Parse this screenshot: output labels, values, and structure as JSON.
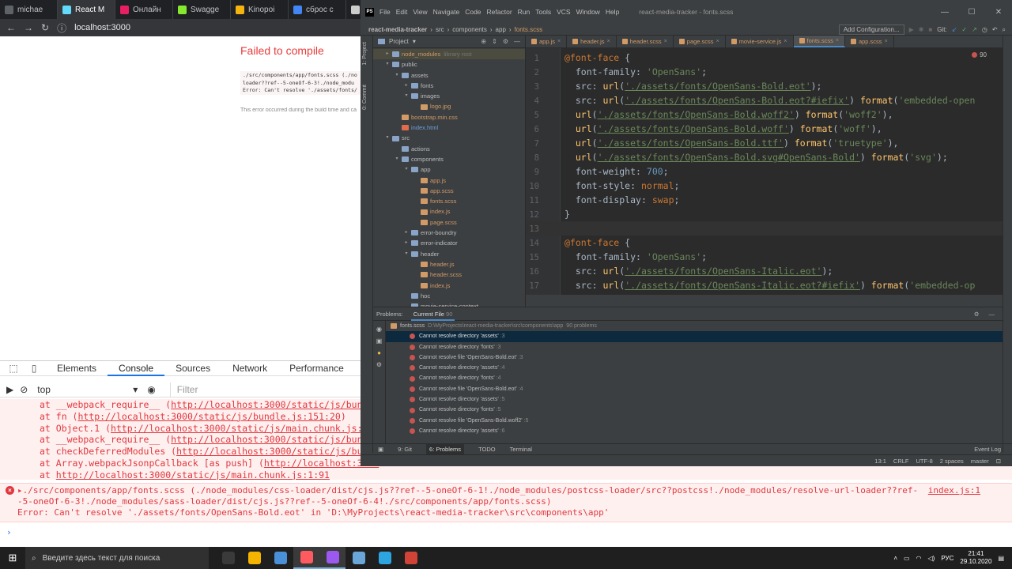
{
  "browser": {
    "tabs": [
      {
        "label": "michae",
        "color": "#5f6368"
      },
      {
        "label": "React M",
        "color": "#61dafb",
        "active": true
      },
      {
        "label": "Онлайн",
        "color": "#e91e63"
      },
      {
        "label": "Swagge",
        "color": "#85ea2d"
      },
      {
        "label": "Kinopoi",
        "color": "#f6b40e"
      },
      {
        "label": "сброс с",
        "color": "#4285f4"
      },
      {
        "label": "K",
        "color": "#cccccc"
      }
    ],
    "address": "localhost:3000"
  },
  "error_page": {
    "title": "Failed to compile",
    "code": "./src/components/app/fonts.scss (./no\nloader??ref--5-oneOf-6-3!./node_modu\nError: Can't resolve './assets/fonts/",
    "note": "This error occurred during the build time and ca"
  },
  "devtools": {
    "tabs": [
      "Elements",
      "Console",
      "Sources",
      "Network",
      "Performance",
      "Me"
    ],
    "active_tab": "Console",
    "context": "top",
    "filter_placeholder": "Filter",
    "trace": [
      {
        "pre": "at __webpack_require__ (",
        "link": "http://localhost:3000/static/js/bundle",
        "post": ""
      },
      {
        "pre": "at fn (",
        "link": "http://localhost:3000/static/js/bundle.js:151:20",
        "post": ")"
      },
      {
        "pre": "at Object.1 (",
        "link": "http://localhost:3000/static/js/main.chunk.js:968",
        "post": ""
      },
      {
        "pre": "at __webpack_require__ (",
        "link": "http://localhost:3000/static/js/bundle",
        "post": ""
      },
      {
        "pre": "at checkDeferredModules (",
        "link": "http://localhost:3000/static/js/bundl",
        "post": ""
      },
      {
        "pre": "at Array.webpackJsonpCallback [as push] (",
        "link": "http://localhost:3000",
        "post": ""
      },
      {
        "pre": "at ",
        "link": "http://localhost:3000/static/js/main.chunk.js:1:91",
        "post": ""
      }
    ],
    "error_line1": "▸./src/components/app/fonts.scss (./node_modules/css-loader/dist/cjs.js??ref--5-oneOf-6-1!./node_modules/postcss-loader/src??postcss!./node_modules/resolve-url-loader??ref-",
    "error_line2": "-5-oneOf-6-3!./node_modules/sass-loader/dist/cjs.js??ref--5-oneOf-6-4!./src/components/app/fonts.scss)",
    "error_line3": "Error: Can't resolve './assets/fonts/OpenSans-Bold.eot' in 'D:\\MyProjects\\react-media-tracker\\src\\components\\app'",
    "error_source": "index.js:1",
    "prompt": "›"
  },
  "ide": {
    "menu": [
      "File",
      "Edit",
      "View",
      "Navigate",
      "Code",
      "Refactor",
      "Run",
      "Tools",
      "VCS",
      "Window",
      "Help"
    ],
    "window_title": "react-media-tracker - fonts.scss",
    "breadcrumbs": [
      "react-media-tracker",
      "src",
      "components",
      "app",
      "fonts.scss"
    ],
    "add_config": "Add Configuration...",
    "git_label": "Git:",
    "project_label": "Project",
    "left_tool_labels": [
      "1: Project",
      "0: Commit"
    ],
    "tree": [
      {
        "depth": 0,
        "label": "node_modules",
        "suffix": "library root",
        "type": "lib",
        "arrow": "▸"
      },
      {
        "depth": 0,
        "label": "public",
        "type": "folder",
        "arrow": "▾"
      },
      {
        "depth": 1,
        "label": "assets",
        "type": "folder",
        "arrow": "▾"
      },
      {
        "depth": 2,
        "label": "fonts",
        "type": "folder",
        "arrow": "▸"
      },
      {
        "depth": 2,
        "label": "images",
        "type": "folder",
        "arrow": "▾"
      },
      {
        "depth": 3,
        "label": "logo.jpg",
        "type": "file"
      },
      {
        "depth": 1,
        "label": "bootstrap.min.css",
        "type": "file"
      },
      {
        "depth": 1,
        "label": "index.html",
        "type": "html"
      },
      {
        "depth": 0,
        "label": "src",
        "type": "folder",
        "arrow": "▾"
      },
      {
        "depth": 1,
        "label": "actions",
        "type": "folder",
        "arrow": ""
      },
      {
        "depth": 1,
        "label": "components",
        "type": "folder",
        "arrow": "▾"
      },
      {
        "depth": 2,
        "label": "app",
        "type": "folder",
        "arrow": "▾"
      },
      {
        "depth": 3,
        "label": "app.js",
        "type": "file"
      },
      {
        "depth": 3,
        "label": "app.scss",
        "type": "file"
      },
      {
        "depth": 3,
        "label": "fonts.scss",
        "type": "file"
      },
      {
        "depth": 3,
        "label": "index.js",
        "type": "file"
      },
      {
        "depth": 3,
        "label": "page.scss",
        "type": "file"
      },
      {
        "depth": 2,
        "label": "error-boundry",
        "type": "folder",
        "arrow": "▸"
      },
      {
        "depth": 2,
        "label": "error-indicator",
        "type": "folder",
        "arrow": "▸"
      },
      {
        "depth": 2,
        "label": "header",
        "type": "folder",
        "arrow": "▾"
      },
      {
        "depth": 3,
        "label": "header.js",
        "type": "file"
      },
      {
        "depth": 3,
        "label": "header.scss",
        "type": "file"
      },
      {
        "depth": 3,
        "label": "index.js",
        "type": "file"
      },
      {
        "depth": 2,
        "label": "hoc",
        "type": "folder",
        "arrow": ""
      },
      {
        "depth": 2,
        "label": "movie-service-context",
        "type": "folder",
        "arrow": ""
      }
    ],
    "editor_tabs": [
      "app.js",
      "header.js",
      "header.scss",
      "page.scss",
      "movie-service.js",
      "fonts.scss",
      "app.scss"
    ],
    "active_editor_tab": "fonts.scss",
    "problem_hint": "90",
    "code_lines": [
      [
        [
          "kw",
          "@font-face"
        ],
        [
          "sp",
          " {"
        ]
      ],
      [
        [
          "sp",
          "  "
        ],
        [
          "pr",
          "font-family"
        ],
        [
          "sp",
          ": "
        ],
        [
          "st",
          "'OpenSans'"
        ],
        [
          "sp",
          ";"
        ]
      ],
      [
        [
          "sp",
          "  "
        ],
        [
          "pr",
          "src"
        ],
        [
          "sp",
          ": "
        ],
        [
          "fn",
          "url"
        ],
        [
          "sp",
          "("
        ],
        [
          "st",
          "'./assets/fonts/OpenSans-Bold.eot'"
        ],
        [
          "sp",
          ");"
        ]
      ],
      [
        [
          "sp",
          "  "
        ],
        [
          "pr",
          "src"
        ],
        [
          "sp",
          ": "
        ],
        [
          "fn",
          "url"
        ],
        [
          "sp",
          "("
        ],
        [
          "st",
          "'./assets/fonts/OpenSans-Bold.eot?#iefix'"
        ],
        [
          "sp",
          ") "
        ],
        [
          "fn",
          "format"
        ],
        [
          "sp",
          "("
        ],
        [
          "st",
          "'embedded-open"
        ]
      ],
      [
        [
          "sp",
          "  "
        ],
        [
          "fn",
          "url"
        ],
        [
          "sp",
          "("
        ],
        [
          "st",
          "'./assets/fonts/OpenSans-Bold.woff2'"
        ],
        [
          "sp",
          ") "
        ],
        [
          "fn",
          "format"
        ],
        [
          "sp",
          "("
        ],
        [
          "st",
          "'woff2'"
        ],
        [
          "sp",
          "),"
        ]
      ],
      [
        [
          "sp",
          "  "
        ],
        [
          "fn",
          "url"
        ],
        [
          "sp",
          "("
        ],
        [
          "st",
          "'./assets/fonts/OpenSans-Bold.woff'"
        ],
        [
          "sp",
          ") "
        ],
        [
          "fn",
          "format"
        ],
        [
          "sp",
          "("
        ],
        [
          "st",
          "'woff'"
        ],
        [
          "sp",
          "),"
        ]
      ],
      [
        [
          "sp",
          "  "
        ],
        [
          "fn",
          "url"
        ],
        [
          "sp",
          "("
        ],
        [
          "st",
          "'./assets/fonts/OpenSans-Bold.ttf'"
        ],
        [
          "sp",
          ") "
        ],
        [
          "fn",
          "format"
        ],
        [
          "sp",
          "("
        ],
        [
          "st",
          "'truetype'"
        ],
        [
          "sp",
          "),"
        ]
      ],
      [
        [
          "sp",
          "  "
        ],
        [
          "fn",
          "url"
        ],
        [
          "sp",
          "("
        ],
        [
          "st",
          "'./assets/fonts/OpenSans-Bold.svg#OpenSans-Bold'"
        ],
        [
          "sp",
          ") "
        ],
        [
          "fn",
          "format"
        ],
        [
          "sp",
          "("
        ],
        [
          "st",
          "'svg'"
        ],
        [
          "sp",
          ");"
        ]
      ],
      [
        [
          "sp",
          "  "
        ],
        [
          "pr",
          "font-weight"
        ],
        [
          "sp",
          ": "
        ],
        [
          "nm",
          "700"
        ],
        [
          "sp",
          ";"
        ]
      ],
      [
        [
          "sp",
          "  "
        ],
        [
          "pr",
          "font-style"
        ],
        [
          "sp",
          ": "
        ],
        [
          "kw",
          "normal"
        ],
        [
          "sp",
          ";"
        ]
      ],
      [
        [
          "sp",
          "  "
        ],
        [
          "pr",
          "font-display"
        ],
        [
          "sp",
          ": "
        ],
        [
          "kw",
          "swap"
        ],
        [
          "sp",
          ";"
        ]
      ],
      [
        [
          "sp",
          "}"
        ]
      ],
      [
        [
          "sp",
          ""
        ]
      ],
      [
        [
          "kw",
          "@font-face"
        ],
        [
          "sp",
          " {"
        ]
      ],
      [
        [
          "sp",
          "  "
        ],
        [
          "pr",
          "font-family"
        ],
        [
          "sp",
          ": "
        ],
        [
          "st",
          "'OpenSans'"
        ],
        [
          "sp",
          ";"
        ]
      ],
      [
        [
          "sp",
          "  "
        ],
        [
          "pr",
          "src"
        ],
        [
          "sp",
          ": "
        ],
        [
          "fn",
          "url"
        ],
        [
          "sp",
          "("
        ],
        [
          "st",
          "'./assets/fonts/OpenSans-Italic.eot'"
        ],
        [
          "sp",
          ");"
        ]
      ],
      [
        [
          "sp",
          "  "
        ],
        [
          "pr",
          "src"
        ],
        [
          "sp",
          ": "
        ],
        [
          "fn",
          "url"
        ],
        [
          "sp",
          "("
        ],
        [
          "st",
          "'./assets/fonts/OpenSans-Italic.eot?#iefix'"
        ],
        [
          "sp",
          ") "
        ],
        [
          "fn",
          "format"
        ],
        [
          "sp",
          "("
        ],
        [
          "st",
          "'embedded-op"
        ]
      ]
    ],
    "problems": {
      "label": "Problems:",
      "tab": "Current File",
      "tab_count": "90",
      "file": "fonts.scss",
      "file_path": "D:\\MyProjects\\react-media-tracker\\src\\components\\app",
      "file_count": "90 problems",
      "side_labels": [
        "Z: Structure",
        "2: Favorites",
        "npm"
      ],
      "items": [
        {
          "msg": "Cannot resolve directory 'assets'",
          "loc": ":3",
          "sel": true
        },
        {
          "msg": "Cannot resolve directory 'fonts'",
          "loc": ":3"
        },
        {
          "msg": "Cannot resolve file 'OpenSans-Bold.eot'",
          "loc": ":3"
        },
        {
          "msg": "Cannot resolve directory 'assets'",
          "loc": ":4"
        },
        {
          "msg": "Cannot resolve directory 'fonts'",
          "loc": ":4"
        },
        {
          "msg": "Cannot resolve file 'OpenSans-Bold.eot'",
          "loc": ":4"
        },
        {
          "msg": "Cannot resolve directory 'assets'",
          "loc": ":5"
        },
        {
          "msg": "Cannot resolve directory 'fonts'",
          "loc": ":5"
        },
        {
          "msg": "Cannot resolve file 'OpenSans-Bold.woff2'",
          "loc": ":5"
        },
        {
          "msg": "Cannot resolve directory 'assets'",
          "loc": ":6"
        }
      ]
    },
    "tool_windows": [
      "9: Git",
      "6: Problems",
      "TODO",
      "Terminal"
    ],
    "active_tool": "6: Problems",
    "event_log": "Event Log",
    "status": [
      "13:1",
      "CRLF",
      "UTF-8",
      "2 spaces",
      "master"
    ]
  },
  "taskbar": {
    "search_placeholder": "Введите здесь текст для поиска",
    "apps": [
      "#3a3a3a",
      "#f4b400",
      "#4a90d9",
      "#ff5a5f",
      "#9b59f0",
      "#6aa6d8",
      "#2ca5e0",
      "#d04437"
    ],
    "lang": "РУС",
    "time": "21:41",
    "date": "29.10.2020"
  }
}
